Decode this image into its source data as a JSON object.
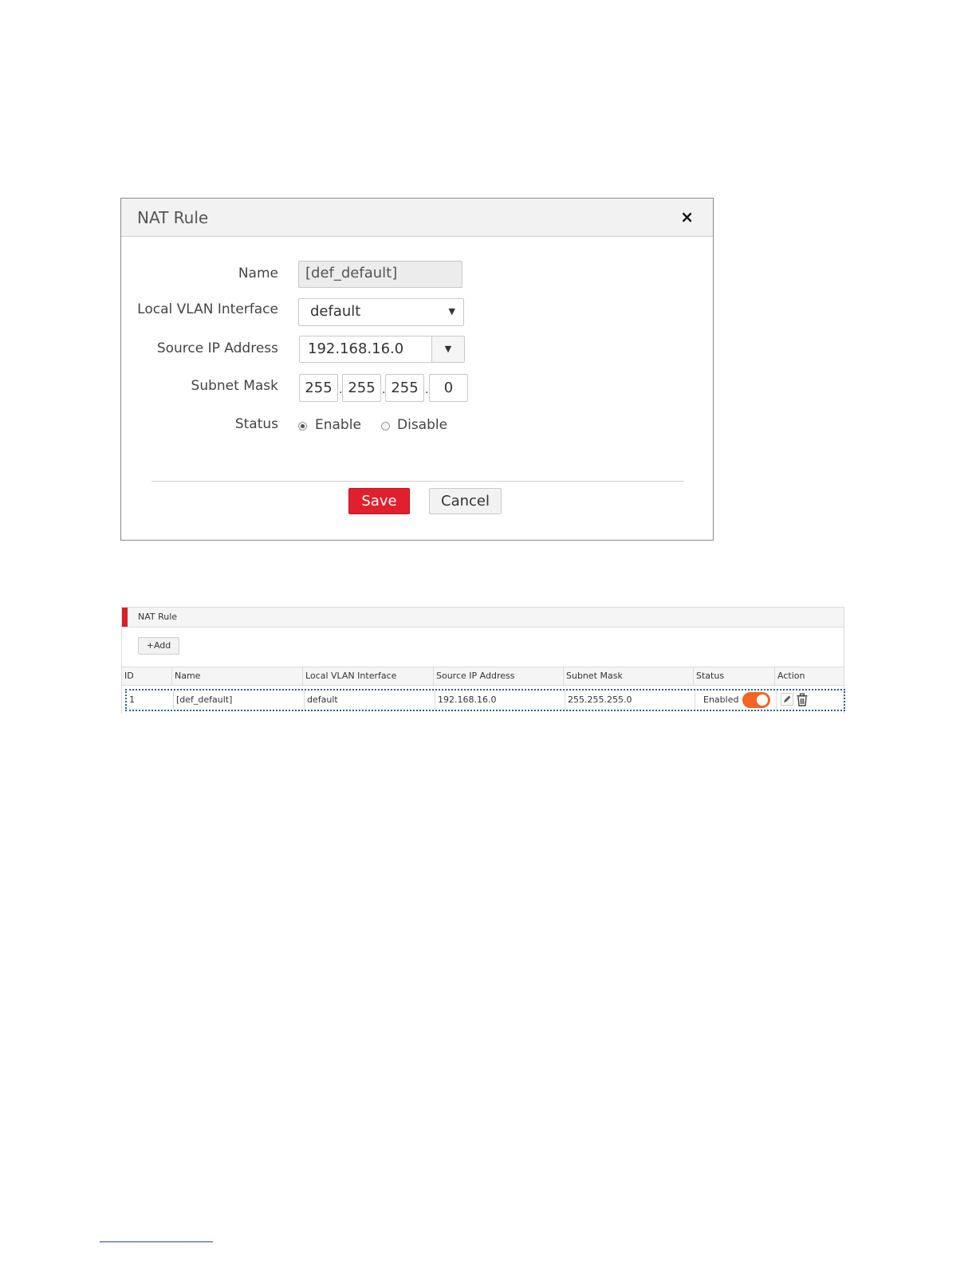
{
  "dialog": {
    "title": "NAT Rule",
    "close_symbol": "×",
    "fields": {
      "name": {
        "label": "Name",
        "value": "[def_default]"
      },
      "vlan": {
        "label": "Local VLAN Interface",
        "value": "default"
      },
      "source_ip": {
        "label": "Source IP Address",
        "value": "192.168.16.0"
      },
      "subnet_mask": {
        "label": "Subnet Mask",
        "octets": [
          "255",
          "255",
          "255",
          "0"
        ]
      },
      "status": {
        "label": "Status",
        "options": [
          "Enable",
          "Disable"
        ],
        "selected": "Enable"
      }
    },
    "buttons": {
      "save": "Save",
      "cancel": "Cancel"
    },
    "colors": {
      "save_bg": "#e0202e"
    }
  },
  "list": {
    "title": "NAT Rule",
    "add_label": "+Add",
    "columns": [
      "ID",
      "Name",
      "Local VLAN Interface",
      "Source IP Address",
      "Subnet Mask",
      "Status",
      "Action"
    ],
    "rows": [
      {
        "id": "1",
        "name": "[def_default]",
        "vlan": "default",
        "source_ip": "192.168.16.0",
        "subnet_mask": "255.255.255.0",
        "status": "Enabled",
        "toggle_on": true,
        "actions": [
          "edit-icon",
          "delete-icon"
        ]
      }
    ],
    "colors": {
      "accent": "#d7202a",
      "toggle_on": "#f26522",
      "row_focus": "#2e5d94"
    }
  }
}
